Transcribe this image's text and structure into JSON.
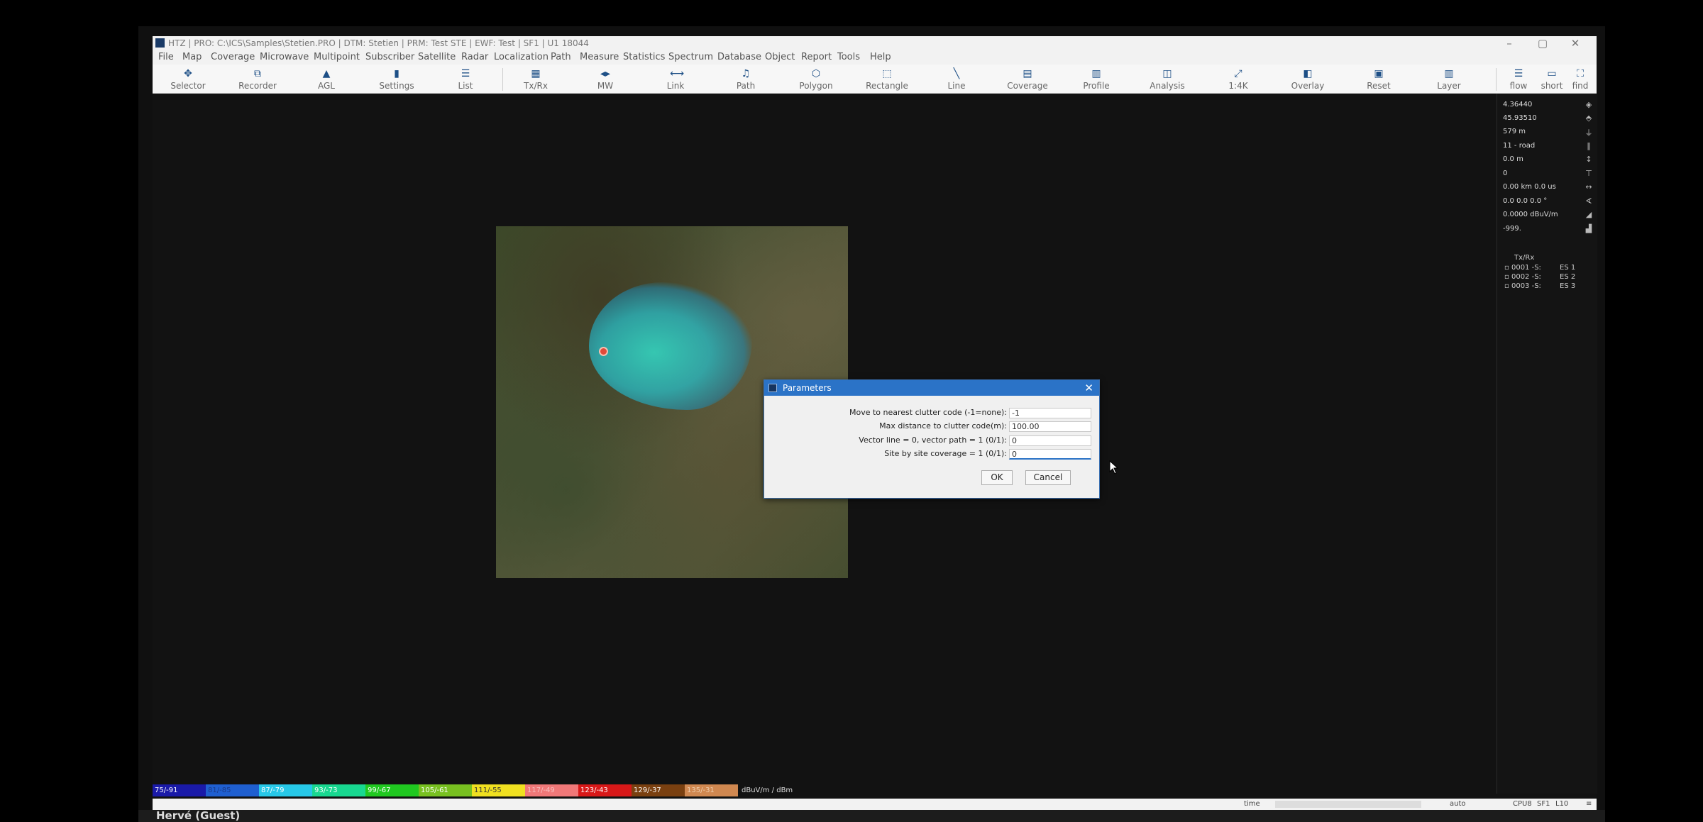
{
  "window": {
    "title": "HTZ | PRO: C:\\ICS\\Samples\\Stetien.PRO | DTM: Stetien | PRM: Test STE | EWF: Test | SF1 | U1 18044"
  },
  "menu": [
    "File",
    "Map",
    "Coverage",
    "Microwave",
    "Multipoint",
    "Subscriber",
    "Satellite",
    "Radar",
    "Localization",
    "Path",
    "Measure",
    "Statistics",
    "Spectrum",
    "Database",
    "Object",
    "Report",
    "Tools",
    "Help"
  ],
  "toolbar": [
    {
      "label": "Selector",
      "icon": "selector-icon",
      "glyph": "✥"
    },
    {
      "label": "Recorder",
      "icon": "recorder-icon",
      "glyph": "⧉"
    },
    {
      "label": "AGL",
      "icon": "agl-icon",
      "glyph": "▲"
    },
    {
      "label": "Settings",
      "icon": "settings-icon",
      "glyph": "▮"
    },
    {
      "label": "List",
      "icon": "list-icon",
      "glyph": "☰"
    },
    {
      "label": "Tx/Rx",
      "icon": "txrx-icon",
      "glyph": "▦"
    },
    {
      "label": "MW",
      "icon": "mw-icon",
      "glyph": "◂▸"
    },
    {
      "label": "Link",
      "icon": "link-icon",
      "glyph": "⟷"
    },
    {
      "label": "Path",
      "icon": "path-icon",
      "glyph": "♫"
    },
    {
      "label": "Polygon",
      "icon": "polygon-icon",
      "glyph": "⬡"
    },
    {
      "label": "Rectangle",
      "icon": "rectangle-icon",
      "glyph": "⬚"
    },
    {
      "label": "Line",
      "icon": "line-icon",
      "glyph": "╲"
    },
    {
      "label": "Coverage",
      "icon": "coverage-icon",
      "glyph": "▤"
    },
    {
      "label": "Profile",
      "icon": "profile-icon",
      "glyph": "▥"
    },
    {
      "label": "Analysis",
      "icon": "analysis-icon",
      "glyph": "◫"
    },
    {
      "label": "1:4K",
      "icon": "zoom-icon",
      "glyph": "⤢"
    },
    {
      "label": "Overlay",
      "icon": "overlay-icon",
      "glyph": "◧"
    },
    {
      "label": "Reset",
      "icon": "reset-icon",
      "glyph": "▣"
    },
    {
      "label": "Layer",
      "icon": "layer-icon",
      "glyph": "▥"
    },
    {
      "label": "flow",
      "icon": "flow-icon",
      "glyph": "☰"
    },
    {
      "label": "short",
      "icon": "short-icon",
      "glyph": "▭"
    },
    {
      "label": "find",
      "icon": "find-icon",
      "glyph": "⛶"
    }
  ],
  "readouts": [
    "4.36440",
    "45.93510",
    "579 m",
    "11 - road",
    "0.0 m",
    "0",
    "0.00 km 0.0 us",
    "0.0 0.0 0.0 °",
    "0.0000 dBuV/m",
    "-999."
  ],
  "txrx": {
    "header": "Tx/Rx",
    "rows": [
      {
        "id": "0001 -S:",
        "name": "ES 1"
      },
      {
        "id": "0002 -S:",
        "name": "ES 2"
      },
      {
        "id": "0003 -S:",
        "name": "ES 3"
      }
    ]
  },
  "dialog": {
    "title": "Parameters",
    "close": "✕",
    "params": [
      {
        "label": "Move to nearest clutter code (-1=none):",
        "value": "-1"
      },
      {
        "label": "Max distance to clutter code(m):",
        "value": "100.00"
      },
      {
        "label": "Vector line = 0, vector path = 1 (0/1):",
        "value": "0"
      },
      {
        "label": "Site by site coverage = 1 (0/1):",
        "value": "0"
      }
    ],
    "ok": "OK",
    "cancel": "Cancel"
  },
  "legend": {
    "items": [
      {
        "label": "75/-91",
        "color": "#1a1aa8",
        "text": "#ffffff"
      },
      {
        "label": "81/-85",
        "color": "#1f5fd0",
        "text": "#1a3a8a"
      },
      {
        "label": "87/-79",
        "color": "#27c8e8",
        "text": "#ffffff"
      },
      {
        "label": "93/-73",
        "color": "#18d890",
        "text": "#ffffff"
      },
      {
        "label": "99/-67",
        "color": "#20c820",
        "text": "#ffffff"
      },
      {
        "label": "105/-61",
        "color": "#78c020",
        "text": "#ffffff"
      },
      {
        "label": "111/-55",
        "color": "#f0e020",
        "text": "#333333"
      },
      {
        "label": "117/-49",
        "color": "#f07878",
        "text": "#f8c0c0"
      },
      {
        "label": "123/-43",
        "color": "#d81818",
        "text": "#ffffff"
      },
      {
        "label": "129/-37",
        "color": "#7a4010",
        "text": "#ffffff"
      },
      {
        "label": "135/-31",
        "color": "#d08850",
        "text": "#f0d0b0"
      }
    ],
    "unit": "dBuV/m / dBm"
  },
  "status": {
    "time_label": "time",
    "auto_label": "auto",
    "cpu": "CPU8",
    "sf": "SF1",
    "level": "L10",
    "menu_glyph": "≡"
  },
  "user": "Hervé (Guest)"
}
